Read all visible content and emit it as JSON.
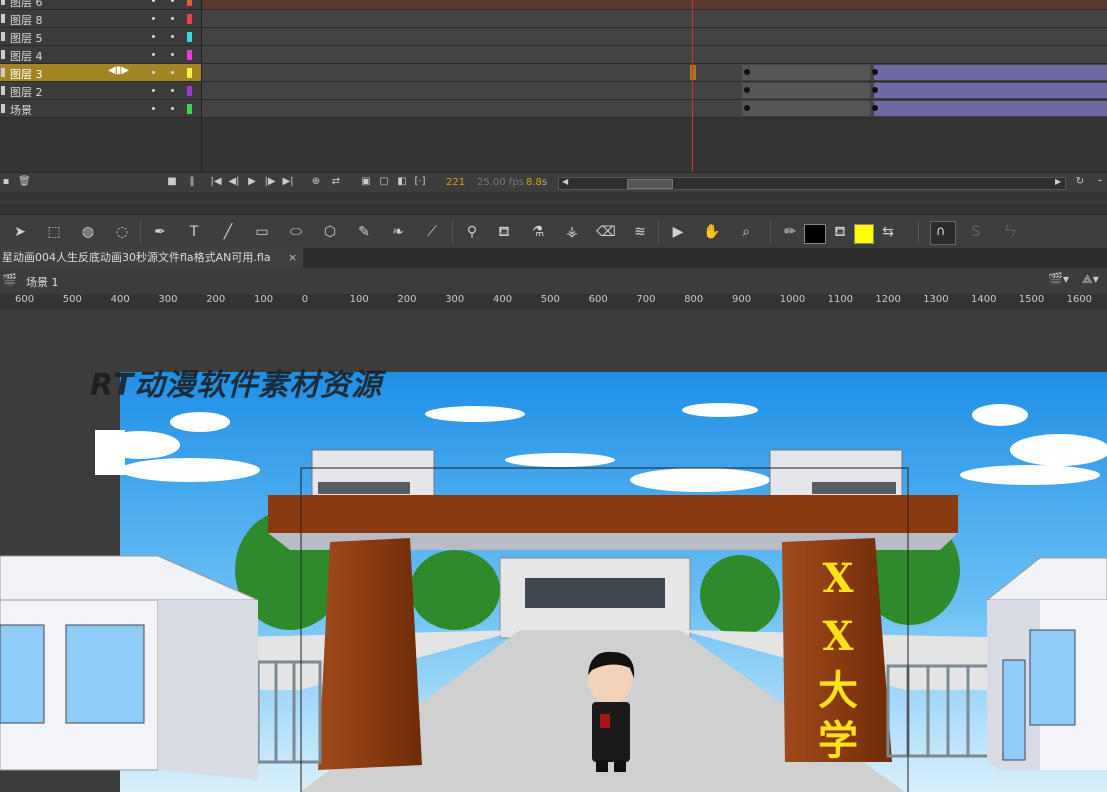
{
  "timeline": {
    "layers": [
      {
        "name": "图层 6",
        "color": "#e05a3b",
        "selected": false
      },
      {
        "name": "图层 8",
        "color": "#e0484b",
        "selected": false
      },
      {
        "name": "图层 5",
        "color": "#3ad6e8",
        "selected": false
      },
      {
        "name": "图层 4",
        "color": "#e23fd8",
        "selected": false
      },
      {
        "name": "图层 3",
        "color": "#f6f24a",
        "selected": true
      },
      {
        "name": "图层 2",
        "color": "#9a3cc6",
        "selected": false
      },
      {
        "name": "场景",
        "color": "#38d84a",
        "selected": false
      }
    ],
    "current_frame": "221",
    "fps": "25.00 fps",
    "time": "8.8",
    "time_unit": "s"
  },
  "document": {
    "tab_title": "星动画004人生反底动画30秒源文件fla格式AN可用.fla",
    "scene_label": "场景 1"
  },
  "ruler": {
    "ticks": [
      "600",
      "500",
      "400",
      "300",
      "200",
      "100",
      "0",
      "100",
      "200",
      "300",
      "400",
      "500",
      "600",
      "700",
      "800",
      "900",
      "1000",
      "1100",
      "1200",
      "1300",
      "1400",
      "1500",
      "1600"
    ]
  },
  "stage": {
    "watermark": "RT动漫软件素材资源",
    "sign_chars": [
      "X",
      "X",
      "大",
      "学"
    ]
  },
  "colors": {
    "stroke": "#000000",
    "fill": "#ffff00",
    "selected_layer": "#a48524",
    "playhead": "#d0342a"
  }
}
